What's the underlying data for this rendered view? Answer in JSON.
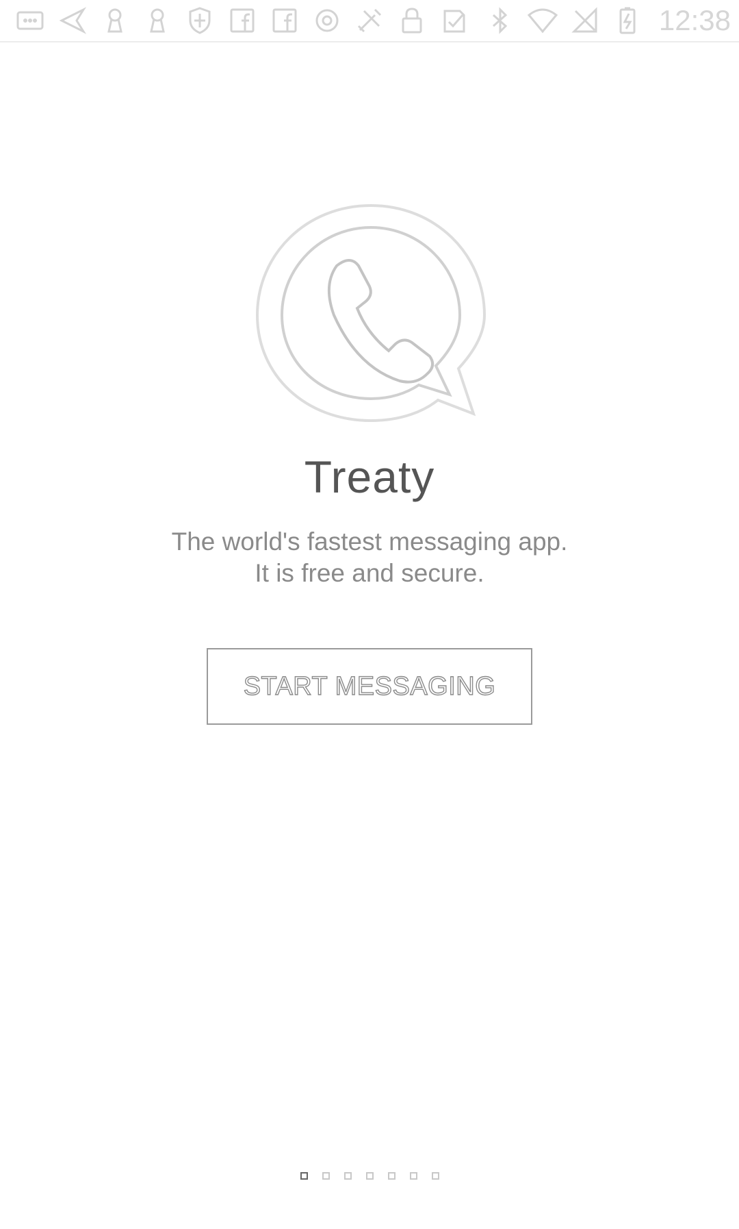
{
  "status_bar": {
    "time": "12:38",
    "left_icons": [
      "more-icon",
      "send-icon",
      "keyhole-icon",
      "keyhole-icon",
      "shield-icon",
      "facebook-icon",
      "facebook-icon",
      "circle-icon",
      "tools-icon",
      "lock-icon",
      "task-icon"
    ],
    "right_icons": [
      "bluetooth-icon",
      "wifi-icon",
      "no-signal-icon",
      "battery-charging-icon"
    ]
  },
  "app": {
    "name": "Treaty",
    "tagline_line1": "The world's fastest messaging app.",
    "tagline_line2": "It is free and secure.",
    "start_button_label": "START MESSAGING"
  },
  "pager": {
    "count": 7,
    "active_index": 0
  },
  "colors": {
    "background": "#ffffff",
    "title": "#555555",
    "tagline": "#8a8a8a",
    "button_border": "#9a9a9a"
  }
}
